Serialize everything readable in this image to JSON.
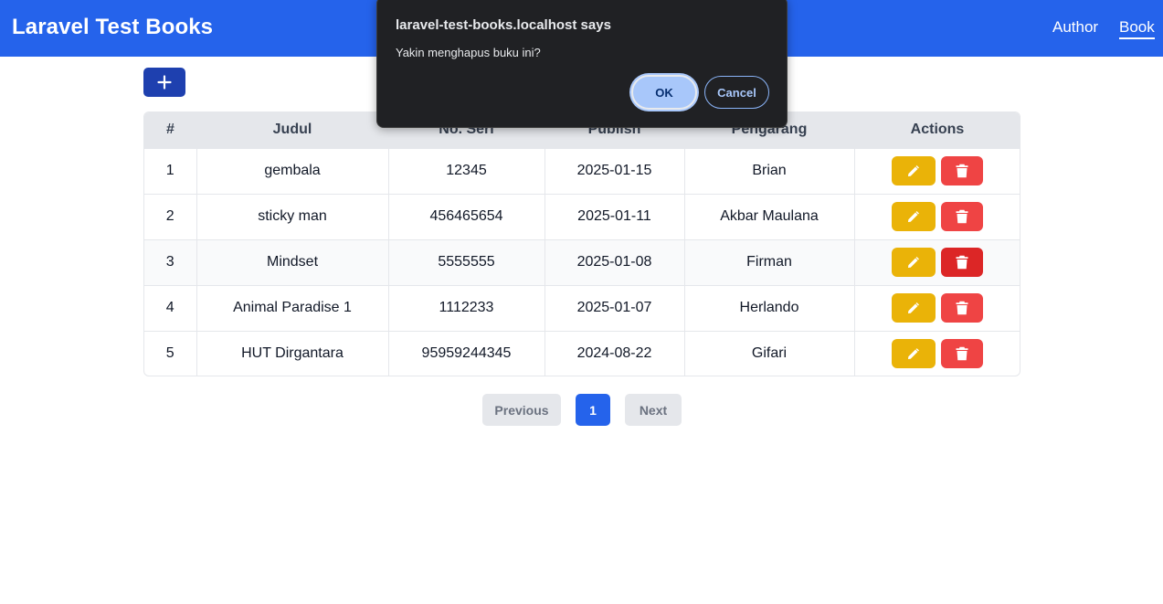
{
  "navbar": {
    "brand": "Laravel Test Books",
    "links": [
      {
        "label": "Author"
      },
      {
        "label": "Book",
        "active": true
      }
    ],
    "color": "#2563eb"
  },
  "toolbar": {
    "add_icon": "plus-icon"
  },
  "table": {
    "headers": [
      "#",
      "Judul",
      "No. Seri",
      "Publish",
      "Pengarang",
      "Actions"
    ],
    "rows": [
      {
        "no": "1",
        "judul": "gembala",
        "seri": "12345",
        "publish": "2025-01-15",
        "pengarang": "Brian"
      },
      {
        "no": "2",
        "judul": "sticky man",
        "seri": "456465654",
        "publish": "2025-01-11",
        "pengarang": "Akbar Maulana"
      },
      {
        "no": "3",
        "judul": "Mindset",
        "seri": "5555555",
        "publish": "2025-01-08",
        "pengarang": "Firman"
      },
      {
        "no": "4",
        "judul": "Animal Paradise 1",
        "seri": "1112233",
        "publish": "2025-01-07",
        "pengarang": "Herlando"
      },
      {
        "no": "5",
        "judul": "HUT Dirgantara",
        "seri": "95959244345",
        "publish": "2024-08-22",
        "pengarang": "Gifari"
      }
    ],
    "edit_icon": "pencil-icon",
    "delete_icon": "trash-icon",
    "edit_color": "#eab308",
    "delete_color": "#ef4444"
  },
  "pagination": {
    "previous": "Previous",
    "current": "1",
    "next": "Next"
  },
  "dialog": {
    "title": "laravel-test-books.localhost says",
    "message": "Yakin menghapus buku ini?",
    "ok": "OK",
    "cancel": "Cancel"
  }
}
